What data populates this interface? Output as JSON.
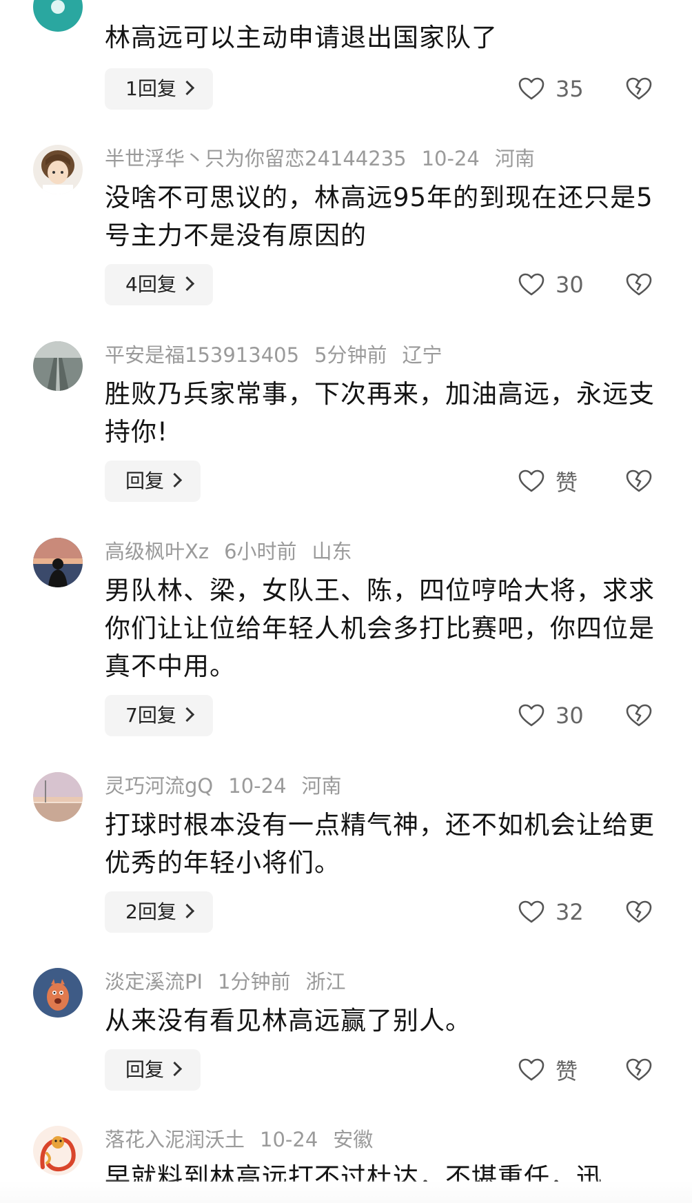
{
  "comments": [
    {
      "user": "",
      "time": "",
      "location": "",
      "text": "林高远可以主动申请退出国家队了",
      "reply_label": "1回复",
      "likes": "35"
    },
    {
      "user": "半世浮华丶只为你留恋24144235",
      "time": "10-24",
      "location": "河南",
      "text": "没啥不可思议的，林高远95年的到现在还只是5号主力不是没有原因的",
      "reply_label": "4回复",
      "likes": "30"
    },
    {
      "user": "平安是福153913405",
      "time": "5分钟前",
      "location": "辽宁",
      "text": "胜败乃兵家常事，下次再来，加油高远，永远支持你!",
      "reply_label": "回复",
      "likes": "赞"
    },
    {
      "user": "高级枫叶Xz",
      "time": "6小时前",
      "location": "山东",
      "text": "男队林、梁，女队王、陈，四位哼哈大将，求求你们让让位给年轻人机会多打比赛吧，你四位是真不中用。",
      "reply_label": "7回复",
      "likes": "30"
    },
    {
      "user": "灵巧河流gQ",
      "time": "10-24",
      "location": "河南",
      "text": "打球时根本没有一点精气神，还不如机会让给更优秀的年轻小将们。",
      "reply_label": "2回复",
      "likes": "32"
    },
    {
      "user": "淡定溪流PI",
      "time": "1分钟前",
      "location": "浙江",
      "text": "从来没有看见林高远赢了别人。",
      "reply_label": "回复",
      "likes": "赞"
    },
    {
      "user": "落花入泥润沃土",
      "time": "10-24",
      "location": "安徽",
      "text": "早就料到林高远打不过杜达，不堪重任，迅",
      "reply_label": "",
      "likes": ""
    }
  ]
}
